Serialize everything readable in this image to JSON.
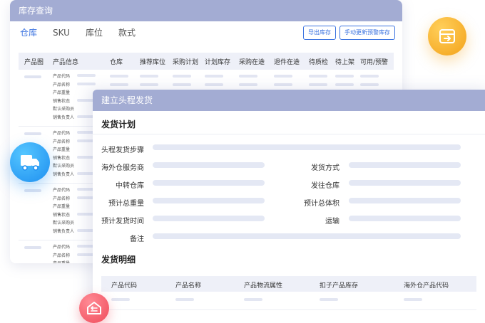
{
  "inventory": {
    "title": "库存查询",
    "tabs": [
      "仓库",
      "SKU",
      "库位",
      "款式"
    ],
    "buttons": {
      "export": "导出库存",
      "update": "手动更新预警库存"
    },
    "columns": [
      "产品图",
      "产品信息",
      "仓库",
      "推荐库位",
      "采购计划",
      "计划库存",
      "采购在途",
      "退件在途",
      "待质检",
      "待上架",
      "可用/预警"
    ],
    "product_fields": [
      "产品代码",
      "产品名称",
      "产品重量",
      "销售状态",
      "默认采购员",
      "销售负责人"
    ]
  },
  "shipment": {
    "title": "建立头程发货",
    "plan_section": "发货计划",
    "fields": {
      "steps": "头程发货步骤",
      "provider": "海外仓服务商",
      "method": "发货方式",
      "transit": "中转仓库",
      "dest": "发往仓库",
      "weight": "预计总重量",
      "volume": "预计总体积",
      "time": "预计发货时间",
      "transport": "运输",
      "remark": "备注"
    },
    "detail_section": "发货明细",
    "detail_columns": [
      "产品代码",
      "产品名称",
      "产品物流属性",
      "扣子产品库存",
      "海外仓产品代码"
    ]
  },
  "colors": {
    "titlebar": "#a3acd3",
    "accent": "#3b73e0",
    "warehouse_icon": "#f3a21a",
    "truck_icon": "#1e8ff0",
    "home_icon": "#f04b5a"
  },
  "icons": {
    "warehouse": "warehouse-export-icon",
    "truck": "truck-icon",
    "home": "home-return-icon"
  }
}
